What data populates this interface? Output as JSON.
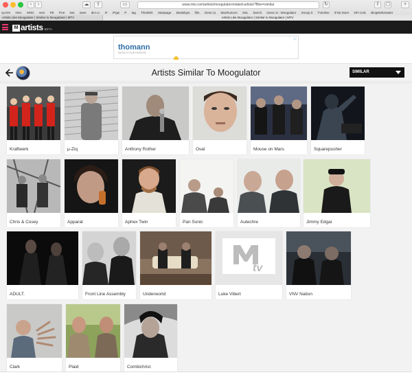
{
  "browser": {
    "url": "www.mtv.com/artists/moogulator/related-artists/?filter=similar",
    "bookmarks": [
      "sycOS",
      "NSA",
      "MOD",
      "sem",
      "FB",
      "Fine",
      "kas",
      "twee",
      "dict.cc",
      "IF",
      "IPgw",
      "P",
      "tag",
      "ThinkNR",
      "Startpage",
      "Beatsbyw",
      "film",
      "Gesrc.is",
      "MacRumors",
      "SSL",
      "bench",
      "Gesrc.is - Moogulator",
      "Snoop it",
      "TVenlive",
      "iFixit Store",
      "DFI Calc",
      "BingWebmaster"
    ],
    "tabs": [
      "Artists Like Moogulator | Similar to Moogulator | MTV",
      "Artists Like Moogulator | Similar to Moogulator | MTV"
    ]
  },
  "site": {
    "logo_mark": "M",
    "logo_text": "artists",
    "logo_beta": "BETA"
  },
  "ad": {
    "brand": "thomann",
    "brand_sub": "MUSIC IS OUR PASSION",
    "choice_icon": "ad-choices-icon"
  },
  "header": {
    "title": "Artists Similar To Moogulator",
    "select_value": "SIMILAR"
  },
  "artists": [
    {
      "name": "Kraftwerk"
    },
    {
      "name": "µ-Ziq"
    },
    {
      "name": "Anthony Rother"
    },
    {
      "name": "Oval"
    },
    {
      "name": "Mouse on Mars"
    },
    {
      "name": "Squarepusher"
    },
    {
      "name": "Chris & Cosey"
    },
    {
      "name": "Apparat"
    },
    {
      "name": "Aphex Twin"
    },
    {
      "name": "Pan Sonic"
    },
    {
      "name": "Autechre"
    },
    {
      "name": "Jimmy Edgar"
    },
    {
      "name": "ADULT."
    },
    {
      "name": "Front Line Assembly"
    },
    {
      "name": "Underworld"
    },
    {
      "name": "Luke Vibert"
    },
    {
      "name": "VNV Nation"
    },
    {
      "name": "Clark"
    },
    {
      "name": "Plaid"
    },
    {
      "name": "Combichrist"
    }
  ],
  "colors": {
    "accent": "#e8366f",
    "header_bg": "#1b1b1b",
    "select_bg": "#111111"
  }
}
